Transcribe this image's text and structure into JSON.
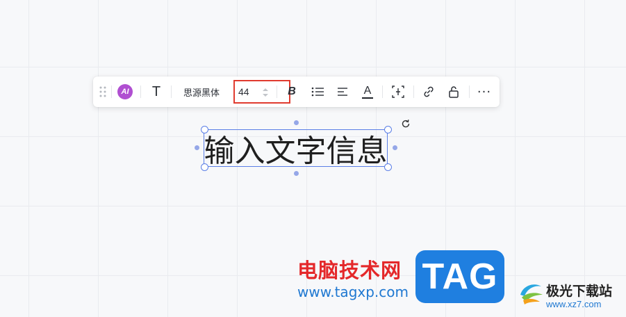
{
  "toolbar": {
    "ai_label": "AI",
    "text_tool": "T",
    "font_name": "思源黑体",
    "font_size": "44",
    "bold_label": "B",
    "color_label": "A",
    "more_label": "···"
  },
  "canvas": {
    "text_content": "输入文字信息"
  },
  "watermark": {
    "cn_text": "电脑技术网",
    "url": "www.tagxp.com",
    "tag_label": "TAG",
    "site_name": "极光下载站",
    "site_url": "www.xz7.com"
  },
  "colors": {
    "selection": "#5b7fe6",
    "highlight_box": "#e03b2f",
    "ai_badge": "#b04fd1",
    "tag_bg": "#1f7fe0"
  },
  "icons": [
    "drag-handle-icon",
    "text-tool-icon",
    "stepper-icon",
    "bold-icon",
    "list-icon",
    "align-icon",
    "font-color-icon",
    "frame-icon",
    "link-icon",
    "lock-icon",
    "more-icon",
    "rotate-icon"
  ]
}
